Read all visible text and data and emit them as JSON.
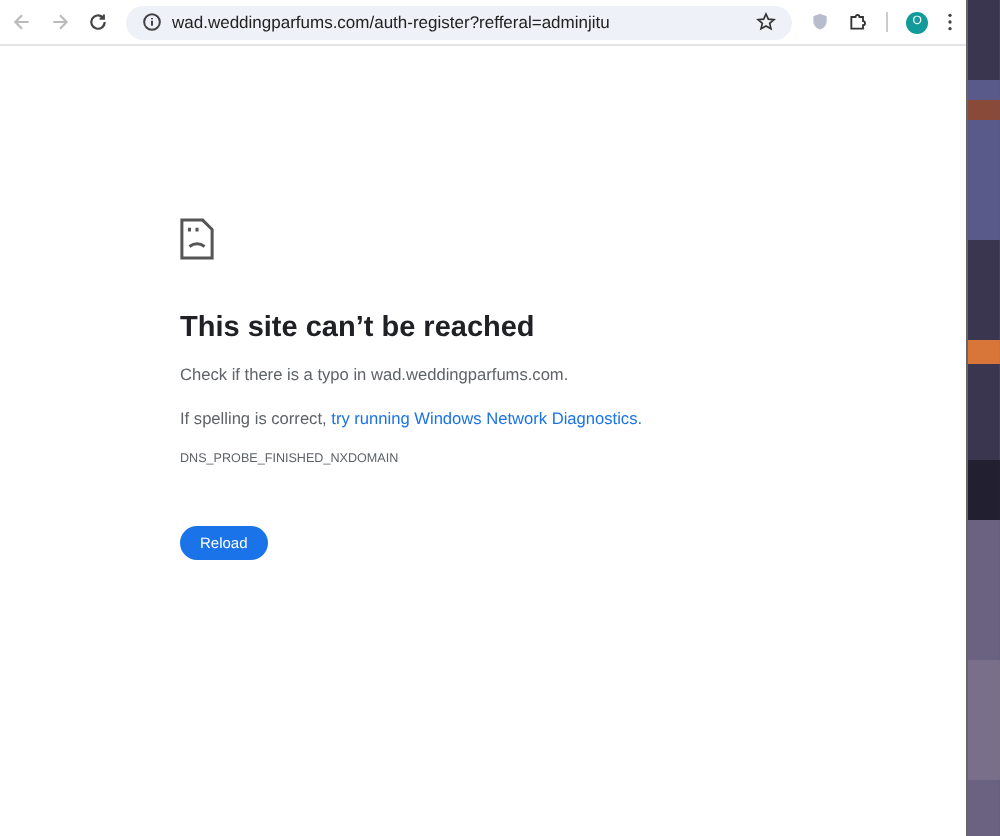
{
  "toolbar": {
    "url": "wad.weddingparfums.com/auth-register?refferal=adminjitu",
    "profile_initial": "O"
  },
  "error": {
    "title": "This site can’t be reached",
    "check_text": "Check if there is a typo in wad.weddingparfums.com.",
    "spelling_text": "If spelling is correct,",
    "link": "try running Windows Network Diagnostics.",
    "code": "DNS_PROBE_FINISHED_NXDOMAIN",
    "button": "Reload"
  }
}
